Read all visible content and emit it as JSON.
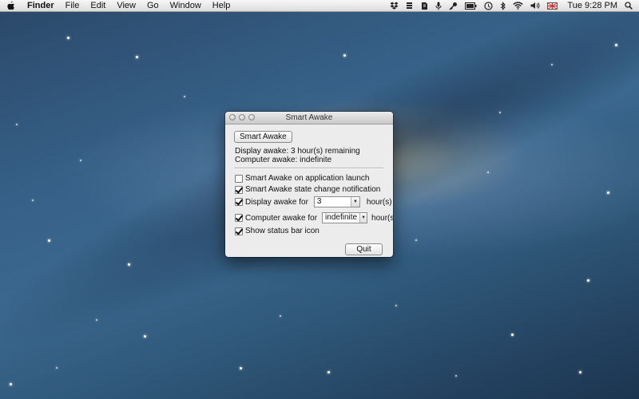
{
  "menubar": {
    "app_name": "Finder",
    "items": [
      "File",
      "Edit",
      "View",
      "Go",
      "Window",
      "Help"
    ],
    "clock": "Tue 9:28 PM",
    "status_icons": [
      "dropbox-icon",
      "stack-icon",
      "evernote-icon",
      "microphone-icon",
      "key-icon",
      "battery-icon",
      "time-machine-icon",
      "bluetooth-icon",
      "wifi-icon",
      "volume-icon",
      "input-source-icon",
      "spotlight-icon"
    ]
  },
  "window": {
    "title": "Smart Awake",
    "smart_awake_button": "Smart Awake",
    "display_status": "Display awake: 3 hour(s) remaining",
    "computer_status": "Computer awake: indefinite",
    "options": {
      "launch": {
        "label": "Smart Awake on application launch",
        "checked": false
      },
      "notification": {
        "label": "Smart Awake state change notification",
        "checked": true
      },
      "display": {
        "label": "Display awake for",
        "value": "3",
        "unit": "hour(s)",
        "checked": true
      },
      "computer": {
        "label": "Computer awake for",
        "value": "indefinite",
        "unit": "hour(s)",
        "checked": true
      },
      "status_icon": {
        "label": "Show status bar icon",
        "checked": true
      }
    },
    "quit_button": "Quit"
  }
}
